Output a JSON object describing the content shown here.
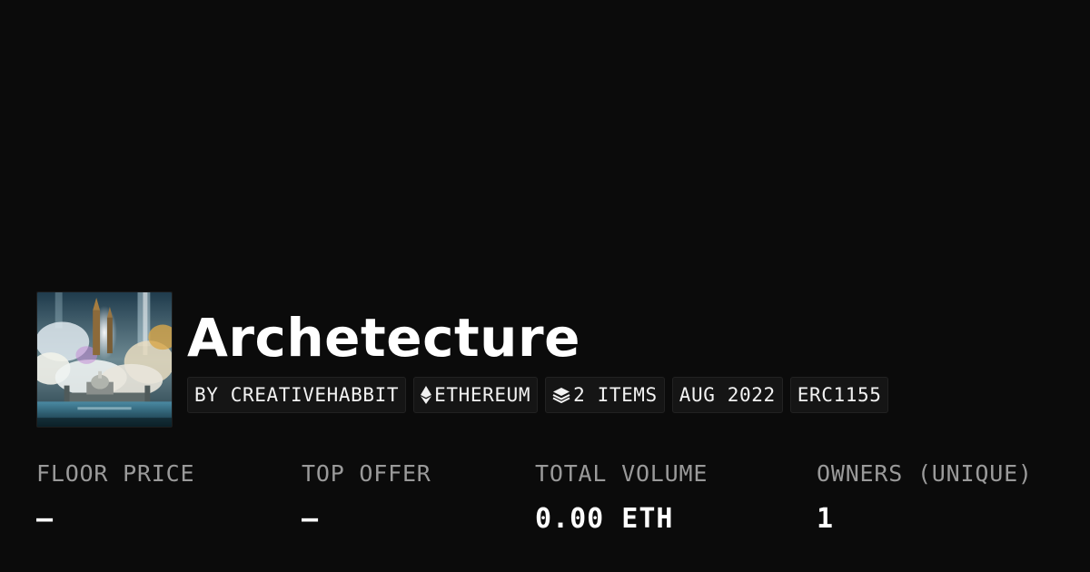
{
  "collection": {
    "name": "Archetecture",
    "thumbnail_alt": "Archetecture",
    "chips": [
      {
        "icon": "",
        "label": "BY CREATIVEHABBIT"
      },
      {
        "icon": "ethereum-icon",
        "label": "ETHEREUM"
      },
      {
        "icon": "layers-icon",
        "label": "2 ITEMS"
      },
      {
        "icon": "",
        "label": "AUG 2022"
      },
      {
        "icon": "",
        "label": "ERC1155"
      }
    ]
  },
  "stats": [
    {
      "label": "FLOOR PRICE",
      "value": "—"
    },
    {
      "label": "TOP OFFER",
      "value": "—"
    },
    {
      "label": "TOTAL VOLUME",
      "value": "0.00 ETH"
    },
    {
      "label": "OWNERS (UNIQUE)",
      "value": "1"
    }
  ],
  "colors": {
    "background": "#0b0b0b",
    "chip_background": "#151515",
    "label_gray": "#9a9a9a",
    "text_white": "#ffffff"
  }
}
